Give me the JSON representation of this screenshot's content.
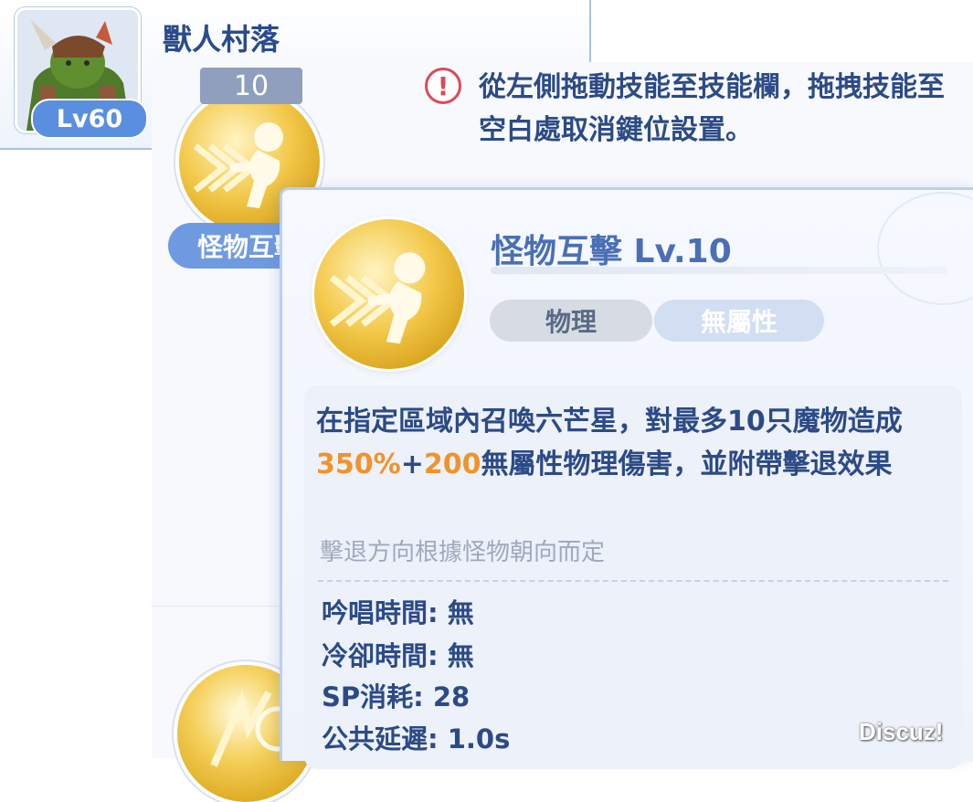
{
  "header": {
    "map_name": "獸人村落",
    "avatar_level": "Lv60"
  },
  "skill_slot": {
    "level": "10",
    "label": "怪物互擊"
  },
  "hint": {
    "icon": "exclamation-circle-icon",
    "text": "從左側拖動技能至技能欄，拖拽技能至空白處取消鍵位設置。"
  },
  "tooltip": {
    "title": "怪物互擊 Lv.10",
    "tags": [
      "物理",
      "無屬性"
    ],
    "description": {
      "p1": "在指定區域內召喚六芒星，對最多10只魔物造成",
      "v1": "350%",
      "p2": "+",
      "v2": "200",
      "p3": "無屬性物理傷害，並附帶擊退效果"
    },
    "note": "擊退方向根據怪物朝向而定",
    "stats": {
      "cast_time": "吟唱時間: 無",
      "cooldown": "冷卻時間: 無",
      "sp_cost": "SP消耗: 28",
      "global_delay": "公共延遲: 1.0s"
    }
  },
  "watermark": "Discuz!",
  "colors": {
    "accent": "#2c4a86",
    "highlight": "#f2922a",
    "badge_blue": "#5a8fe0",
    "alert_red": "#d94a5a"
  }
}
